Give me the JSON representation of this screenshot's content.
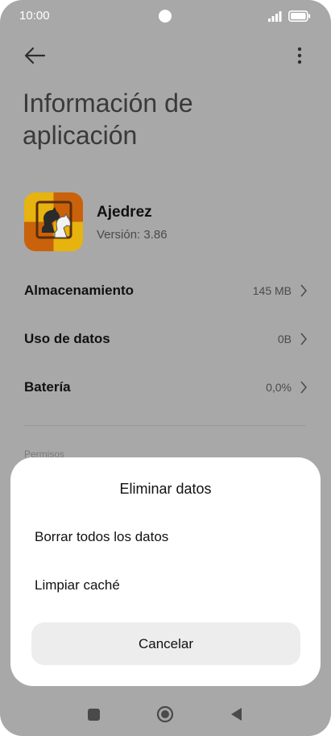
{
  "status_bar": {
    "time": "10:00"
  },
  "header": {
    "title": "Información de aplicación"
  },
  "app": {
    "name": "Ajedrez",
    "version": "Versión: 3.86"
  },
  "rows": [
    {
      "label": "Almacenamiento",
      "value": "145 MB"
    },
    {
      "label": "Uso de datos",
      "value": "0B"
    },
    {
      "label": "Batería",
      "value": "0,0%"
    }
  ],
  "section": {
    "permissions_label": "Permisos"
  },
  "dialog": {
    "title": "Eliminar datos",
    "options": [
      "Borrar todos los datos",
      "Limpiar caché"
    ],
    "cancel_label": "Cancelar"
  },
  "colors": {
    "scrim": "#a8a8a8",
    "sheet": "#ffffff",
    "button_bg": "#ededed"
  },
  "icons": [
    "back-arrow-icon",
    "more-vertical-icon",
    "signal-icon",
    "battery-icon",
    "chess-app-icon",
    "chevron-right-icon",
    "recents-icon",
    "home-icon",
    "back-icon"
  ]
}
